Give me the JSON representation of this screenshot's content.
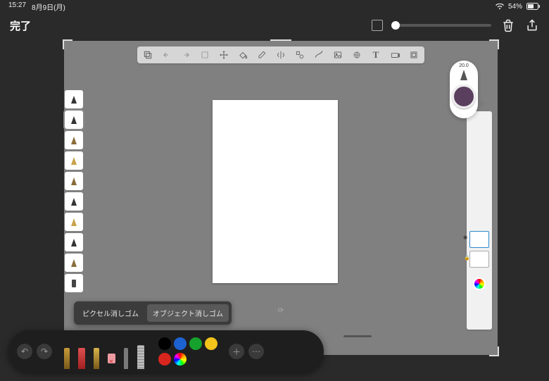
{
  "status": {
    "time": "15:27",
    "date": "8月9日(月)",
    "battery": "54%"
  },
  "header": {
    "done": "完了"
  },
  "brush": {
    "size": "20.0",
    "color": "#5b3f5f"
  },
  "eraser_popup": {
    "pixel": "ピクセル消しゴム",
    "object": "オブジェクト消しゴム"
  },
  "top_tools": {
    "text": "T"
  }
}
